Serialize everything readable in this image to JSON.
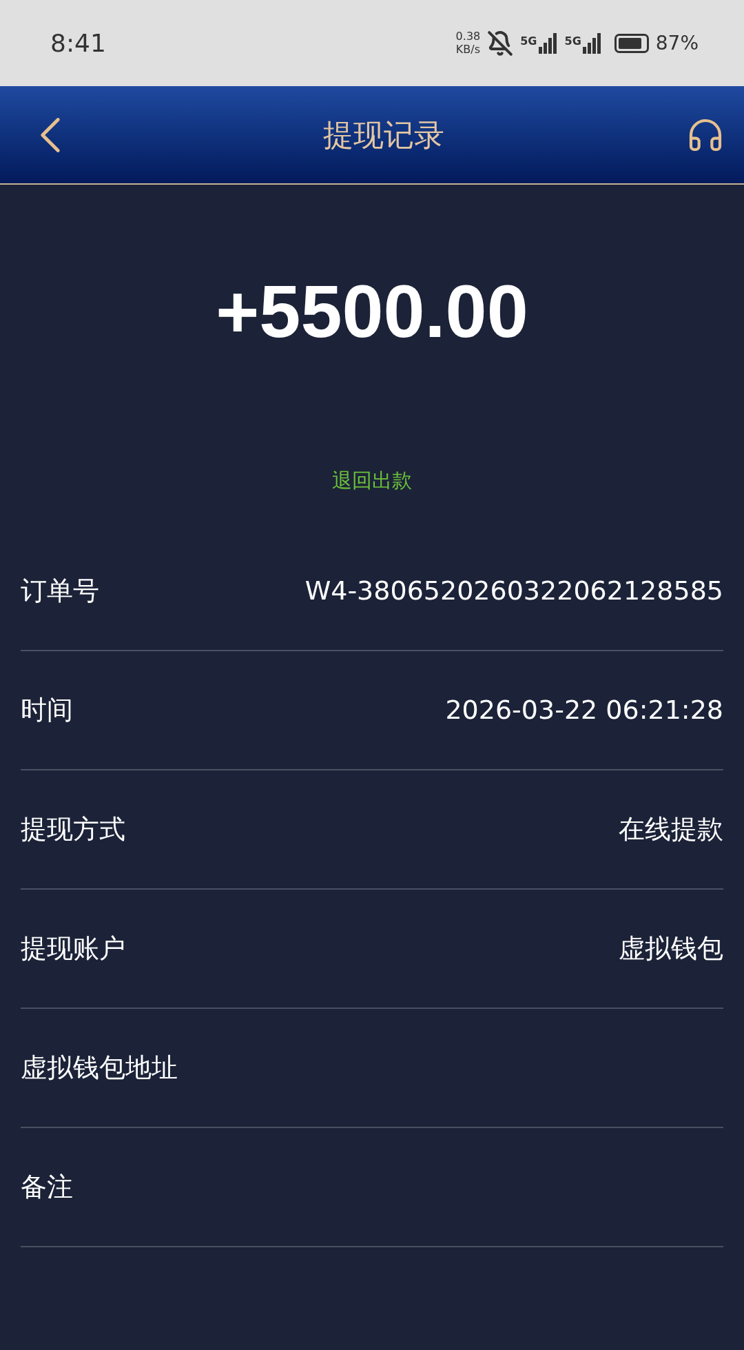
{
  "status_bar": {
    "time": "8:41",
    "net_speed_value": "0.38",
    "net_speed_unit": "KB/s",
    "network_1": "5G",
    "network_2": "5G",
    "battery": "87%"
  },
  "header": {
    "title": "提现记录"
  },
  "amount": "+5500.00",
  "status": "退回出款",
  "details": [
    {
      "label": "订单号",
      "value": "W4-3806520260322062128585"
    },
    {
      "label": "时间",
      "value": "2026-03-22 06:21:28"
    },
    {
      "label": "提现方式",
      "value": "在线提款"
    },
    {
      "label": "提现账户",
      "value": "虚拟钱包"
    },
    {
      "label": "虚拟钱包地址"
    },
    {
      "label": "备注"
    }
  ]
}
